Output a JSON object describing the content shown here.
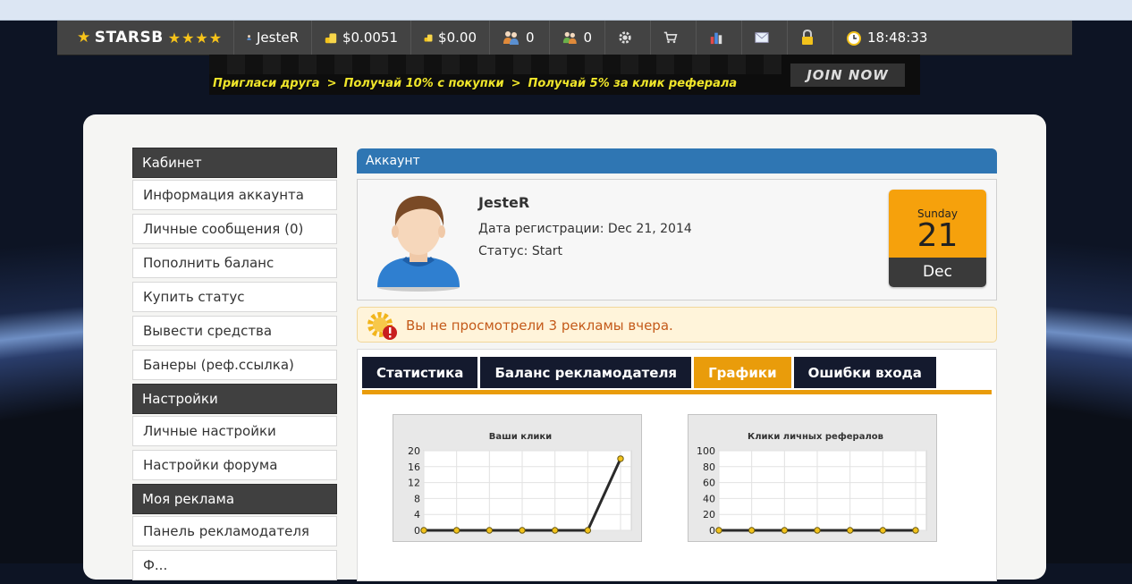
{
  "topbar": {
    "logo": "STARSB",
    "logo_stars": "★★★★",
    "username": "JesteR",
    "balance_main": "$0.0051",
    "balance_ads": "$0.00",
    "referrals_1": "0",
    "referrals_2": "0",
    "time": "18:48:33",
    "icons": [
      "user-icon",
      "coins-icon",
      "coins-icon",
      "referrals-icon",
      "referrals-icon",
      "gear-icon",
      "cart-icon",
      "stats-icon",
      "mail-icon",
      "lock-icon",
      "alarm-clock-icon"
    ]
  },
  "banner": {
    "headline": "",
    "tagline": [
      "Пригласи друга",
      "Получай 10% с покупки",
      "Получай 5% за клик реферала"
    ],
    "join": "JOIN NOW"
  },
  "sidebar": {
    "sections": [
      {
        "title": "Кабинет",
        "items": [
          "Информация аккаунта",
          "Личные сообщения (0)",
          "Пополнить баланс",
          "Купить статус",
          "Вывести средства",
          "Банеры (реф.ссылка)"
        ]
      },
      {
        "title": "Настройки",
        "items": [
          "Личные настройки",
          "Настройки форума"
        ]
      },
      {
        "title": "Моя реклама",
        "items": [
          "Панель рекламодателя",
          "Ф..."
        ]
      }
    ]
  },
  "account": {
    "header": "Аккаунт",
    "name": "JesteR",
    "registration": "Дата регистрации: Dec 21, 2014",
    "status": "Статус: Start",
    "calendar": {
      "weekday": "Sunday",
      "day": "21",
      "month": "Dec"
    }
  },
  "alert": {
    "text": "Вы не просмотрели 3 рекламы вчера."
  },
  "tabs": [
    {
      "label": "Статистика",
      "active": false
    },
    {
      "label": "Баланс рекламодателя",
      "active": false
    },
    {
      "label": "Графики",
      "active": true
    },
    {
      "label": "Ошибки входа",
      "active": false
    }
  ],
  "colors": {
    "accent": "#e99c0b",
    "header_blue": "#2f76b3",
    "nav_dark": "#141a2e"
  },
  "chart_data": [
    {
      "type": "line",
      "title": "Ваши клики",
      "x": [
        1,
        2,
        3,
        4,
        5,
        6,
        7
      ],
      "series": [
        {
          "values": [
            0,
            0,
            0,
            0,
            0,
            0,
            18
          ]
        }
      ],
      "ylim": [
        0,
        20
      ],
      "yticks": [
        0,
        4,
        8,
        12,
        16,
        20
      ],
      "grid": true
    },
    {
      "type": "line",
      "title": "Клики личных рефералов",
      "x": [
        1,
        2,
        3,
        4,
        5,
        6,
        7
      ],
      "series": [
        {
          "values": [
            0,
            0,
            0,
            0,
            0,
            0,
            0
          ]
        }
      ],
      "ylim": [
        0,
        100
      ],
      "yticks": [
        0,
        20,
        40,
        60,
        80,
        100
      ],
      "grid": true
    }
  ]
}
